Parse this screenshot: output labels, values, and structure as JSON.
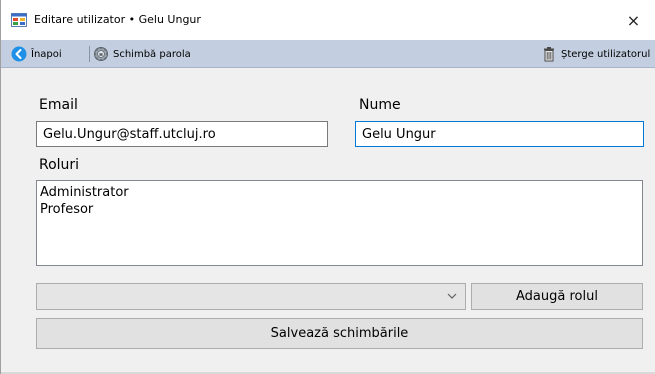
{
  "window": {
    "title": "Editare utilizator • Gelu Ungur",
    "close_glyph": "×"
  },
  "toolbar": {
    "back_label": "Înapoi",
    "change_password_label": "Schimbă parola",
    "delete_user_label": "Șterge utilizatorul"
  },
  "form": {
    "email_label": "Email",
    "email_value": "Gelu.Ungur@staff.utcluj.ro",
    "name_label": "Nume",
    "name_value": "Gelu Ungur",
    "roles_label": "Roluri",
    "roles": [
      "Administrator",
      "Profesor"
    ],
    "role_select_value": "",
    "add_role_label": "Adaugă rolul",
    "save_label": "Salvează schimbările"
  },
  "colors": {
    "toolbar_bg": "#c3cfe0",
    "focus_border": "#0078d7",
    "back_icon": "#1e90e8"
  },
  "icons": {
    "app": "app-window-icon",
    "back": "back-arrow-icon",
    "password": "gear-lock-icon",
    "delete": "trash-icon",
    "dropdown": "chevron-down-icon"
  }
}
